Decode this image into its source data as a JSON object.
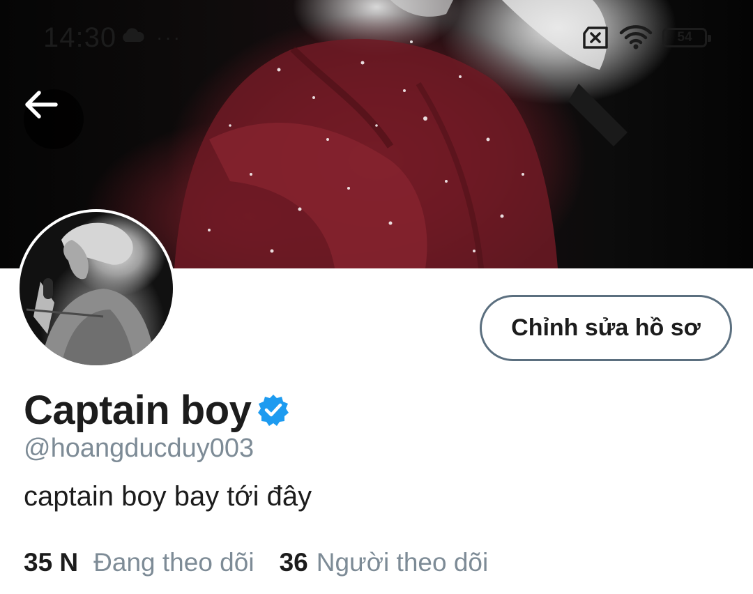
{
  "status_bar": {
    "time": "14:30",
    "more_indicator": "···",
    "battery_level": "54",
    "icons": [
      "cloud-icon",
      "no-sim-icon",
      "wifi-icon",
      "battery-icon"
    ]
  },
  "header": {
    "back_icon": "arrow-left-icon",
    "banner_colors": {
      "primary": "#7a1d28",
      "background": "#0a0a0a"
    }
  },
  "profile": {
    "edit_button_label": "Chỉnh sửa hồ sơ",
    "display_name": "Captain boy",
    "verified": true,
    "verified_color": "#1d9bf0",
    "handle": "@hoangducduy003",
    "bio": "captain boy bay tới đây",
    "stats": [
      {
        "count": "35 N",
        "label": "Đang theo dõi"
      },
      {
        "count": "36",
        "label": "Người theo dõi"
      }
    ]
  },
  "colors": {
    "text_primary": "#1c1c1c",
    "text_secondary": "#7d8b96",
    "button_border": "#5b6f7f"
  }
}
